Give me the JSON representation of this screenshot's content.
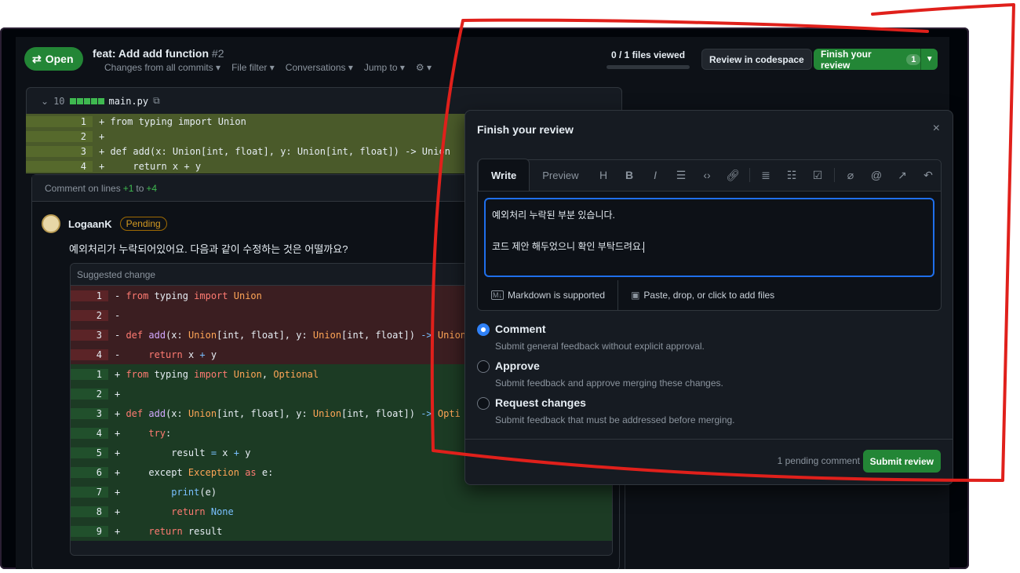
{
  "header": {
    "status": "Open",
    "pr_title": "feat: Add add function",
    "pr_number": "#2",
    "menus": [
      "Changes from all commits ▾",
      "File filter ▾",
      "Conversations ▾",
      "Jump to ▾",
      "⚙ ▾"
    ],
    "files_viewed": "0 / 1 files viewed",
    "files_viewed_progress": 0,
    "review_codespace": "Review in codespace",
    "finish_review": "Finish your review",
    "finish_count": "1"
  },
  "file": {
    "toggle": "⌄",
    "stat": "10",
    "name": "main.py",
    "lines": [
      {
        "n": "1",
        "code": "+ from typing import Union"
      },
      {
        "n": "2",
        "code": "+"
      },
      {
        "n": "3",
        "code": "+ def add(x: Union[int, float], y: Union[int, float]) -> Union"
      },
      {
        "n": "4",
        "code": "+     return x + y"
      }
    ]
  },
  "comment": {
    "header_prefix": "Comment on lines",
    "from": "+1",
    "to_word": "to",
    "to": "+4",
    "author": "LogaanK",
    "badge": "Pending",
    "body": "예외처리가 누락되어있어요. 다음과 같이 수정하는 것은 어떨까요?",
    "suggested_label": "Suggested change"
  },
  "suggestion": {
    "del_nums": [
      "1",
      "2",
      "3",
      "4"
    ],
    "add_nums": [
      "1",
      "2",
      "3",
      "4",
      "5",
      "6",
      "7",
      "8",
      "9"
    ]
  },
  "review": {
    "title": "Finish your review",
    "close": "×",
    "tab_write": "Write",
    "tab_preview": "Preview",
    "text_line1": "예외처리 누락된 부분 있습니다.",
    "text_line2": "코드 제안 해두었으니 확인 부탁드려요.",
    "markdown_note": "Markdown is supported",
    "files_note": "Paste, drop, or click to add files",
    "options": [
      {
        "label": "Comment",
        "desc": "Submit general feedback without explicit approval.",
        "checked": true
      },
      {
        "label": "Approve",
        "desc": "Submit feedback and approve merging these changes.",
        "checked": false
      },
      {
        "label": "Request changes",
        "desc": "Submit feedback that must be addressed before merging.",
        "checked": false
      }
    ],
    "pending_count": "1 pending comment",
    "submit": "Submit review"
  },
  "colors": {
    "accent_green": "#238636",
    "focus_blue": "#1f6feb",
    "annotation_red": "#e0201b"
  }
}
